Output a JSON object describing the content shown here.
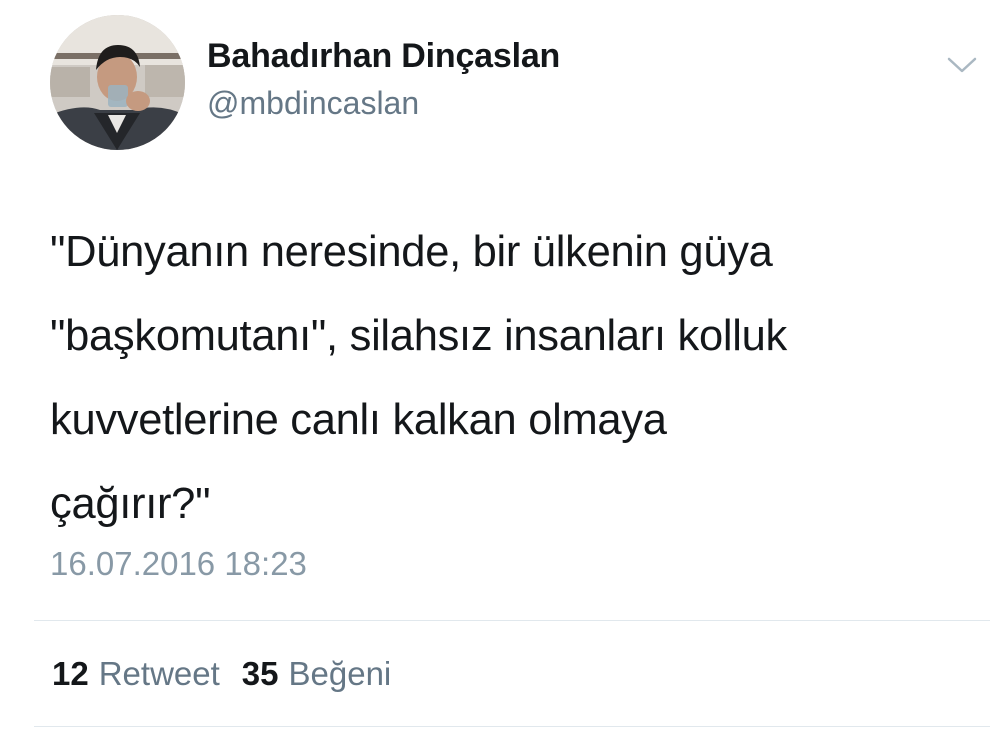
{
  "user": {
    "display_name": "Bahadırhan Dinçaslan",
    "handle": "@mbdincaslan"
  },
  "tweet": {
    "text": "\"Dünyanın neresinde, bir ülkenin güya\n\"başkomutanı\", silahsız insanları kolluk\nkuvvetlerine canlı kalkan olmaya\nçağırır?\"",
    "timestamp": "16.07.2016 18:23"
  },
  "stats": {
    "retweet_count": "12",
    "retweet_label": "Retweet",
    "like_count": "35",
    "like_label": "Beğeni"
  },
  "icons": {
    "menu": "chevron-down-icon",
    "avatar": "profile-photo"
  },
  "colors": {
    "text_primary": "#14171a",
    "text_secondary": "#657786",
    "timestamp": "#8899a6",
    "divider": "#e1e8ed"
  }
}
